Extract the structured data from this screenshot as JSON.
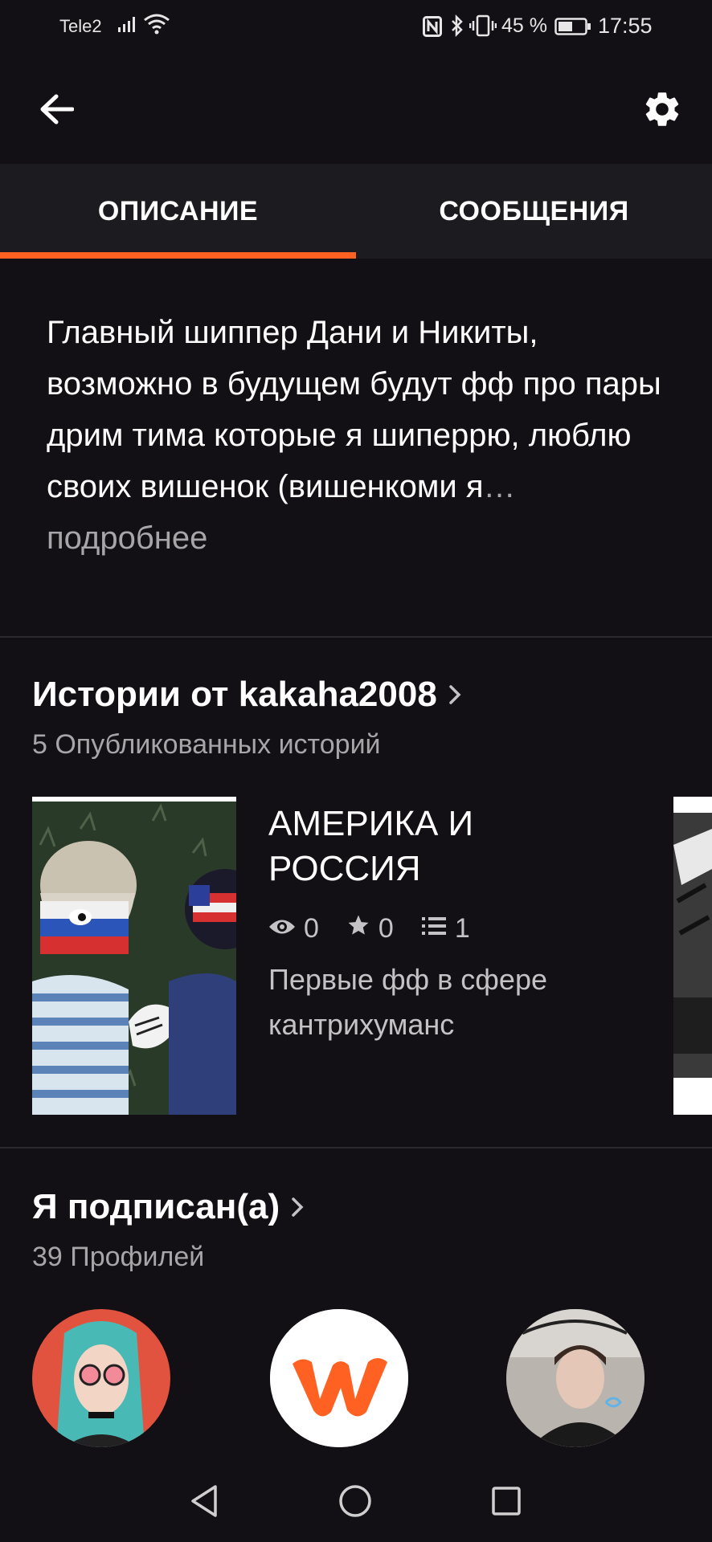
{
  "status_bar": {
    "carrier": "Tele2",
    "battery_percent": "45 %",
    "time": "17:55",
    "icons": [
      "signal-icon",
      "wifi-icon",
      "nfc-icon",
      "bluetooth-icon",
      "vibrate-icon",
      "battery-icon"
    ]
  },
  "header": {
    "back_icon": "arrow-left-icon",
    "settings_icon": "gear-icon"
  },
  "tabs": [
    {
      "label": "ОПИСАНИЕ",
      "active": true
    },
    {
      "label": "СООБЩЕНИЯ",
      "active": false
    }
  ],
  "description": {
    "text": "Главный шиппер Дани и Никиты, возможно в будущем будут фф про пары дрим тима которые я шиперрю, люблю своих вишенок (вишенкоми я",
    "ellipsis": "…",
    "more": " подробнее"
  },
  "stories_section": {
    "title": "Истории от kakaha2008",
    "subtitle": "5 Опубликованных историй",
    "story": {
      "title": "АМЕРИКА И РОССИЯ",
      "views": "0",
      "votes": "0",
      "parts": "1",
      "description": "Первые фф в сфере кантрихуманс"
    }
  },
  "following_section": {
    "title": "Я подписан(а)",
    "subtitle": "39 Профилей"
  },
  "nav": {
    "icons": [
      "back-triangle-icon",
      "home-circle-icon",
      "recents-square-icon"
    ]
  },
  "colors": {
    "background": "#121014",
    "tab_bar": "#1c1b1f",
    "accent": "#ff6122",
    "secondary_text": "#a7a5a8"
  }
}
